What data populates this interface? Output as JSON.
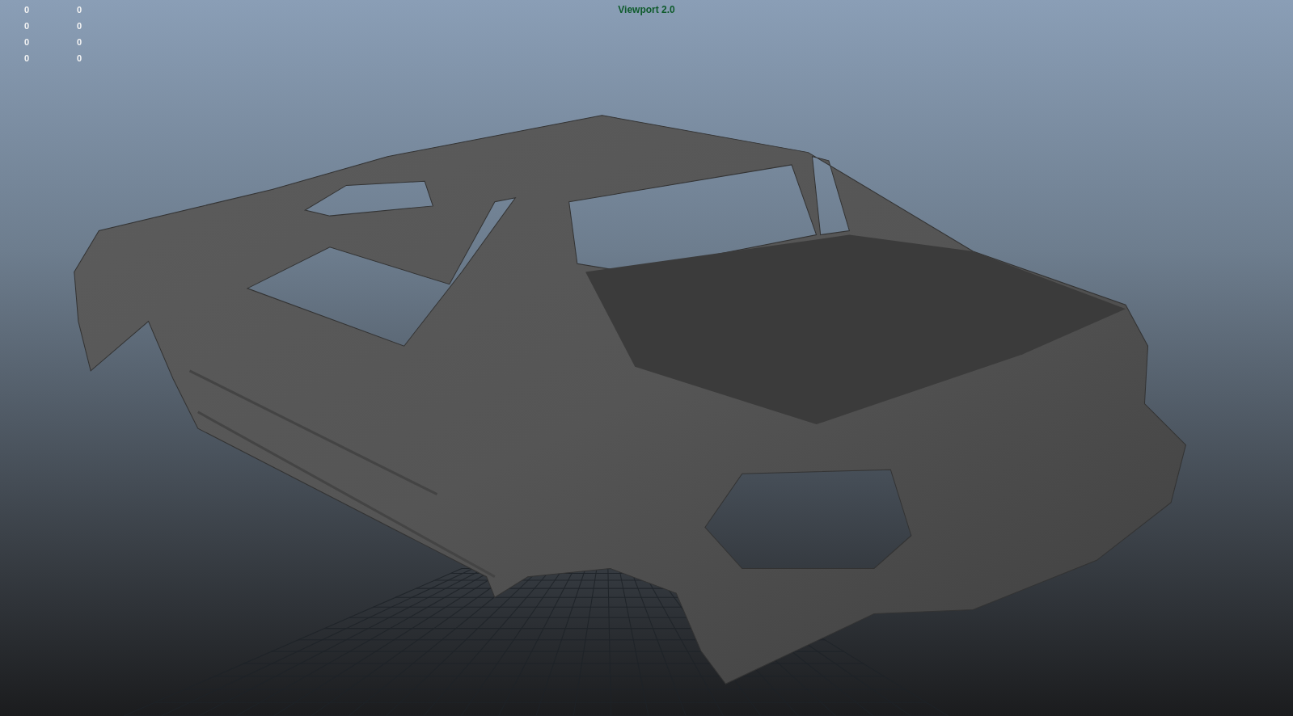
{
  "viewport": {
    "title": "Viewport 2.0"
  },
  "hud_rows": [
    {
      "column_1": "0",
      "column_2": "0"
    },
    {
      "column_1": "0",
      "column_2": "0"
    },
    {
      "column_1": "0",
      "column_2": "0"
    },
    {
      "column_1": "0",
      "column_2": "0"
    }
  ]
}
